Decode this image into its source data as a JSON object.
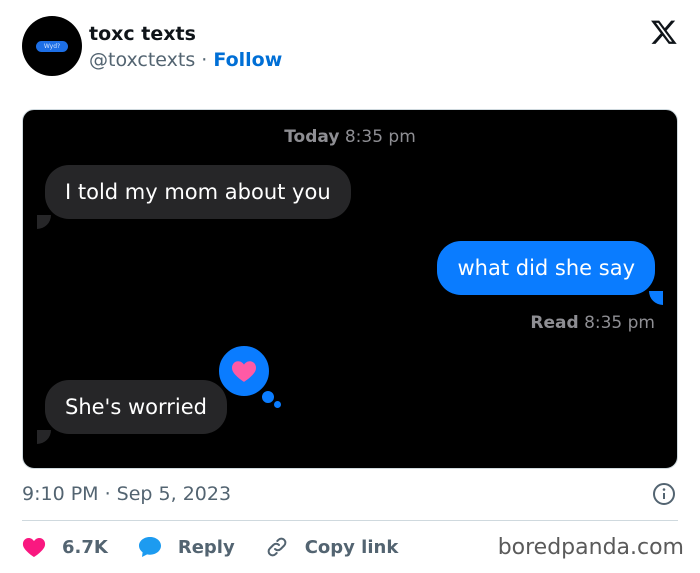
{
  "author": {
    "name": "toxc texts",
    "handle": "@toxctexts",
    "separator": "·",
    "follow_label": "Follow",
    "avatar_text": "Wyd?"
  },
  "conversation": {
    "header_day": "Today",
    "header_time": "8:35 pm",
    "messages": [
      {
        "direction": "incoming",
        "text": "I told my mom about you"
      },
      {
        "direction": "outgoing",
        "text": "what did she say"
      },
      {
        "direction": "incoming",
        "text": "She's worried"
      }
    ],
    "read_label": "Read",
    "read_time": "8:35 pm",
    "tapback_icon": "heart-icon"
  },
  "post": {
    "timestamp": "9:10 PM · Sep 5, 2023"
  },
  "actions": {
    "likes": "6.7K",
    "reply_label": "Reply",
    "copy_link_label": "Copy link"
  },
  "watermark": "boredpanda.com",
  "colors": {
    "accent": "#006fd6",
    "bubble_out": "#0a7cff",
    "bubble_in": "#262628",
    "heart": "#f91880",
    "reply_icon": "#1d9bf0"
  }
}
